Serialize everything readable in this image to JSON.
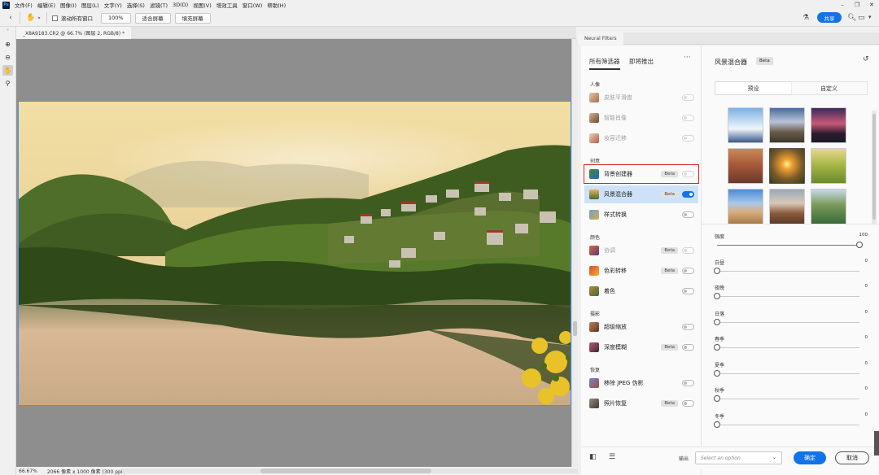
{
  "menubar": {
    "items": [
      "文件(F)",
      "编辑(E)",
      "图像(I)",
      "图层(L)",
      "文字(Y)",
      "选择(S)",
      "滤镜(T)",
      "3D(D)",
      "视图(V)",
      "增效工具",
      "窗口(W)",
      "帮助(H)"
    ]
  },
  "options": {
    "scroll_all_label": "滚动所有窗口",
    "zoom_value": "100%",
    "fit_screen": "适合屏幕",
    "fill_screen": "填充屏幕",
    "share": "共享"
  },
  "document": {
    "tab_title": "_X8A9183.CR2 @ 66.7% (图层 2, RGB/8) *",
    "status_zoom": "66.67%",
    "status_info": "2066 像素 x 1000 像素 (300 ppi)"
  },
  "neural": {
    "panel_title": "Neural Filters",
    "tabs": [
      "所有筛选器",
      "即将推出"
    ],
    "more": "···",
    "sections": [
      "人像",
      "创意",
      "颜色",
      "摄影",
      "恢复"
    ],
    "filters": [
      {
        "label": "皮肤平滑度",
        "badge": "",
        "state": "disabled"
      },
      {
        "label": "智能肖像",
        "badge": "",
        "state": "disabled"
      },
      {
        "label": "妆容迁移",
        "badge": "",
        "state": "disabled"
      },
      {
        "label": "背景创建器",
        "badge": "Beta",
        "state": "off"
      },
      {
        "label": "风景混合器",
        "badge": "Beta",
        "state": "on"
      },
      {
        "label": "样式转换",
        "badge": "",
        "state": "off"
      },
      {
        "label": "协调",
        "badge": "Beta",
        "state": "off"
      },
      {
        "label": "色彩转移",
        "badge": "Beta",
        "state": "off"
      },
      {
        "label": "着色",
        "badge": "",
        "state": "off"
      },
      {
        "label": "超级缩放",
        "badge": "",
        "state": "off"
      },
      {
        "label": "深度模糊",
        "badge": "Beta",
        "state": "off"
      },
      {
        "label": "移除 JPEG 伪影",
        "badge": "",
        "state": "off"
      },
      {
        "label": "照片恢复",
        "badge": "Beta",
        "state": "off"
      }
    ]
  },
  "settings": {
    "title": "风景混合器",
    "badge": "Beta",
    "segments": [
      "预设",
      "自定义"
    ],
    "sliders": [
      {
        "label": "强度",
        "value": "100",
        "fraction": 1
      },
      {
        "label": "白昼",
        "value": "0",
        "fraction": 0
      },
      {
        "label": "夜晚",
        "value": "0",
        "fraction": 0
      },
      {
        "label": "日落",
        "value": "0",
        "fraction": 0
      },
      {
        "label": "春季",
        "value": "0",
        "fraction": 0
      },
      {
        "label": "夏季",
        "value": "0",
        "fraction": 0
      },
      {
        "label": "秋季",
        "value": "0",
        "fraction": 0
      },
      {
        "label": "冬季",
        "value": "0",
        "fraction": 0
      }
    ]
  },
  "footer": {
    "output_label": "输出",
    "output_placeholder": "Select an option",
    "ok": "确定",
    "cancel": "取消"
  },
  "colors": {
    "accent": "#1473e6",
    "selected_row": "#cde2f8",
    "highlight_box": "#e02020"
  }
}
